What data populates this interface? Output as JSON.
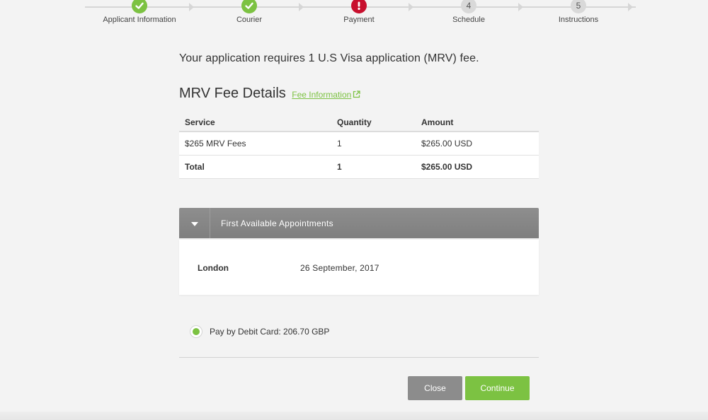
{
  "stepper": {
    "steps": [
      {
        "label": "Applicant Information",
        "status": "done",
        "marker": ""
      },
      {
        "label": "Courier",
        "status": "done",
        "marker": ""
      },
      {
        "label": "Payment",
        "status": "error",
        "marker": ""
      },
      {
        "label": "Schedule",
        "status": "pending",
        "marker": "4"
      },
      {
        "label": "Instructions",
        "status": "pending",
        "marker": "5"
      }
    ]
  },
  "intro": "Your application requires 1 U.S Visa application (MRV) fee.",
  "fee_section": {
    "title": "MRV Fee Details",
    "link_label": "Fee Information",
    "table": {
      "headers": [
        "Service",
        "Quantity",
        "Amount"
      ],
      "rows": [
        [
          "$265 MRV Fees",
          "1",
          "$265.00 USD"
        ]
      ],
      "total": [
        "Total",
        "1",
        "$265.00 USD"
      ]
    }
  },
  "appointments": {
    "title": "First Available Appointments",
    "city": "London",
    "date": "26 September, 2017"
  },
  "payment_option": {
    "label": "Pay by Debit Card: 206.70 GBP",
    "selected": true
  },
  "buttons": {
    "close": "Close",
    "continue": "Continue"
  },
  "colors": {
    "accent_green": "#7cc242",
    "error_red": "#c8102e",
    "button_gray": "#8c8c8c",
    "panel_header": "#868686"
  }
}
